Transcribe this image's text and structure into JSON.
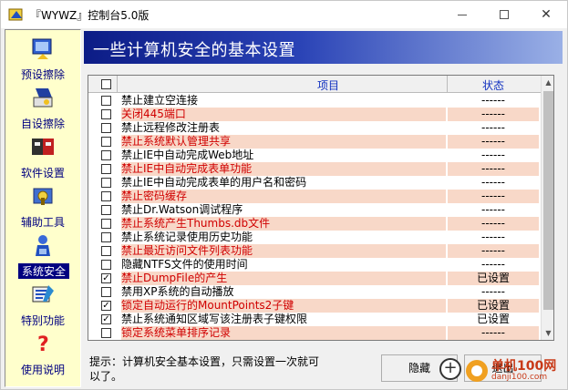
{
  "window": {
    "title": "『WYWZ』控制台5.0版",
    "minimize_glyph": "—",
    "maximize_glyph": "☐",
    "close_glyph": "✕"
  },
  "sidebar": {
    "items": [
      {
        "label": "预设擦除",
        "icon": "preset-erase-icon",
        "active": false
      },
      {
        "label": "自设擦除",
        "icon": "custom-erase-icon",
        "active": false
      },
      {
        "label": "软件设置",
        "icon": "software-settings-icon",
        "active": false
      },
      {
        "label": "辅助工具",
        "icon": "tools-icon",
        "active": false
      },
      {
        "label": "系统安全",
        "icon": "system-security-icon",
        "active": true
      },
      {
        "label": "特别功能",
        "icon": "special-functions-icon",
        "active": false
      },
      {
        "label": "使用说明",
        "icon": "help-icon",
        "active": false
      }
    ]
  },
  "banner": {
    "title": "一些计算机安全的基本设置"
  },
  "list": {
    "columns": {
      "item": "项目",
      "status": "状态"
    },
    "rows": [
      {
        "text": "禁止建立空连接",
        "status": "------",
        "checked": false,
        "alt": false
      },
      {
        "text": "关闭445端口",
        "status": "------",
        "checked": false,
        "alt": true
      },
      {
        "text": "禁止远程修改注册表",
        "status": "------",
        "checked": false,
        "alt": false
      },
      {
        "text": "禁止系统默认管理共享",
        "status": "------",
        "checked": false,
        "alt": true
      },
      {
        "text": "禁止IE中自动完成Web地址",
        "status": "------",
        "checked": false,
        "alt": false
      },
      {
        "text": "禁止IE中自动完成表单功能",
        "status": "------",
        "checked": false,
        "alt": true
      },
      {
        "text": "禁止IE中自动完成表单的用户名和密码",
        "status": "------",
        "checked": false,
        "alt": false
      },
      {
        "text": "禁止密码缓存",
        "status": "------",
        "checked": false,
        "alt": true
      },
      {
        "text": "禁止Dr.Watson调试程序",
        "status": "------",
        "checked": false,
        "alt": false
      },
      {
        "text": "禁止系统产生Thumbs.db文件",
        "status": "------",
        "checked": false,
        "alt": true
      },
      {
        "text": "禁止系统记录使用历史功能",
        "status": "------",
        "checked": false,
        "alt": false
      },
      {
        "text": "禁止最近访问文件列表功能",
        "status": "------",
        "checked": false,
        "alt": true
      },
      {
        "text": "隐藏NTFS文件的使用时间",
        "status": "------",
        "checked": false,
        "alt": false
      },
      {
        "text": "禁止DumpFile的产生",
        "status": "已设置",
        "checked": true,
        "alt": true
      },
      {
        "text": "禁用XP系统的自动播放",
        "status": "------",
        "checked": false,
        "alt": false
      },
      {
        "text": "锁定自动运行的MountPoints2子键",
        "status": "已设置",
        "checked": true,
        "alt": true
      },
      {
        "text": "禁止系统通知区域写该注册表子键权限",
        "status": "已设置",
        "checked": true,
        "alt": false
      },
      {
        "text": "锁定系统菜单排序记录",
        "status": "------",
        "checked": false,
        "alt": true
      }
    ]
  },
  "footer": {
    "hint": "提示：计算机安全基本设置，只需设置一次就可以了。",
    "hide_button": "隐藏",
    "exit_button": "退出",
    "watermark_line1": "单机100网",
    "watermark_line2": "danji100.com"
  },
  "colors": {
    "banner_start": "#0c1c86",
    "alt_row_bg": "#f8d8c8",
    "alt_row_text": "#d00000",
    "sidebar_bg": "#ffffcc",
    "active_label_bg": "#000080"
  }
}
